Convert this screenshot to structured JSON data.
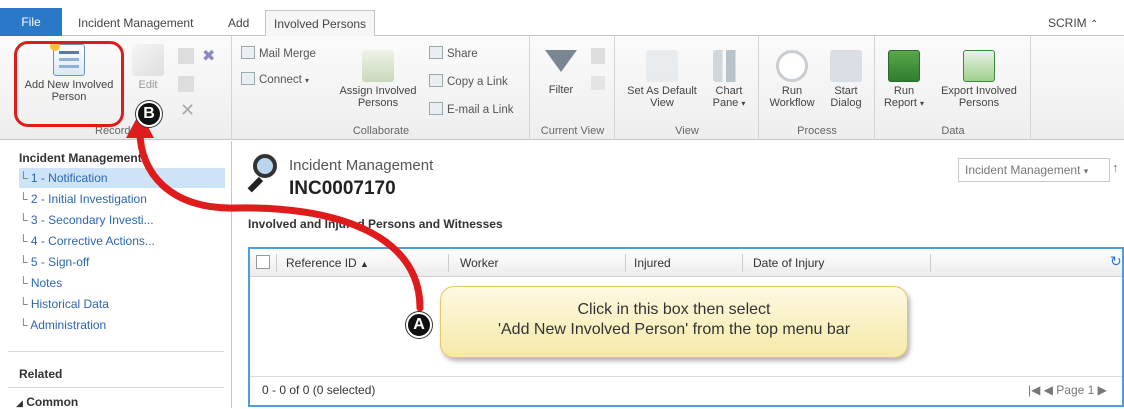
{
  "tabs": {
    "file": "File",
    "incident_management": "Incident Management",
    "add": "Add",
    "involved_persons": "Involved Persons",
    "app_name": "SCRIM"
  },
  "ribbon": {
    "records": {
      "label": "Records",
      "add_new_line1": "Add New Involved",
      "add_new_line2": "Person",
      "edit": "Edit"
    },
    "collaborate": {
      "label": "Collaborate",
      "mail_merge": "Mail Merge",
      "connect": "Connect",
      "assign_line1": "Assign Involved",
      "assign_line2": "Persons",
      "share": "Share",
      "copy_link": "Copy a Link",
      "email_link": "E-mail a Link"
    },
    "current_view": {
      "label": "Current View",
      "filter": "Filter"
    },
    "view": {
      "label": "View",
      "set_default_line1": "Set As Default",
      "set_default_line2": "View",
      "chart_line1": "Chart",
      "chart_line2": "Pane"
    },
    "process": {
      "label": "Process",
      "run_workflow_line1": "Run",
      "run_workflow_line2": "Workflow",
      "start_dialog_line1": "Start",
      "start_dialog_line2": "Dialog"
    },
    "data": {
      "label": "Data",
      "run_report_line1": "Run",
      "run_report_line2": "Report",
      "export_line1": "Export Involved",
      "export_line2": "Persons"
    }
  },
  "nav": {
    "title": "Incident Management",
    "items": [
      "1 - Notification",
      "2 - Initial Investigation",
      "3 - Secondary Investi...",
      "4 - Corrective Actions...",
      "5 - Sign-off",
      "Notes",
      "Historical Data",
      "Administration"
    ],
    "related": "Related",
    "common": "Common"
  },
  "record": {
    "entity": "Incident Management",
    "id": "INC0007170",
    "form_selector": "Incident Management",
    "section": "Involved and Injured Persons and Witnesses"
  },
  "grid": {
    "columns": [
      "Reference ID",
      "Worker",
      "Injured",
      "Date of Injury"
    ],
    "status": "0 - 0 of 0 (0 selected)",
    "page": "Page 1"
  },
  "callout": {
    "line1": "Click in this box then select",
    "line2": "'Add New Involved Person' from the top menu bar"
  },
  "markers": {
    "a": "A",
    "b": "B"
  },
  "colors": {
    "accent": "#2b78c8",
    "annotation": "#e01b1b",
    "grid_border": "#4d9de0",
    "link": "#2b66b3"
  }
}
